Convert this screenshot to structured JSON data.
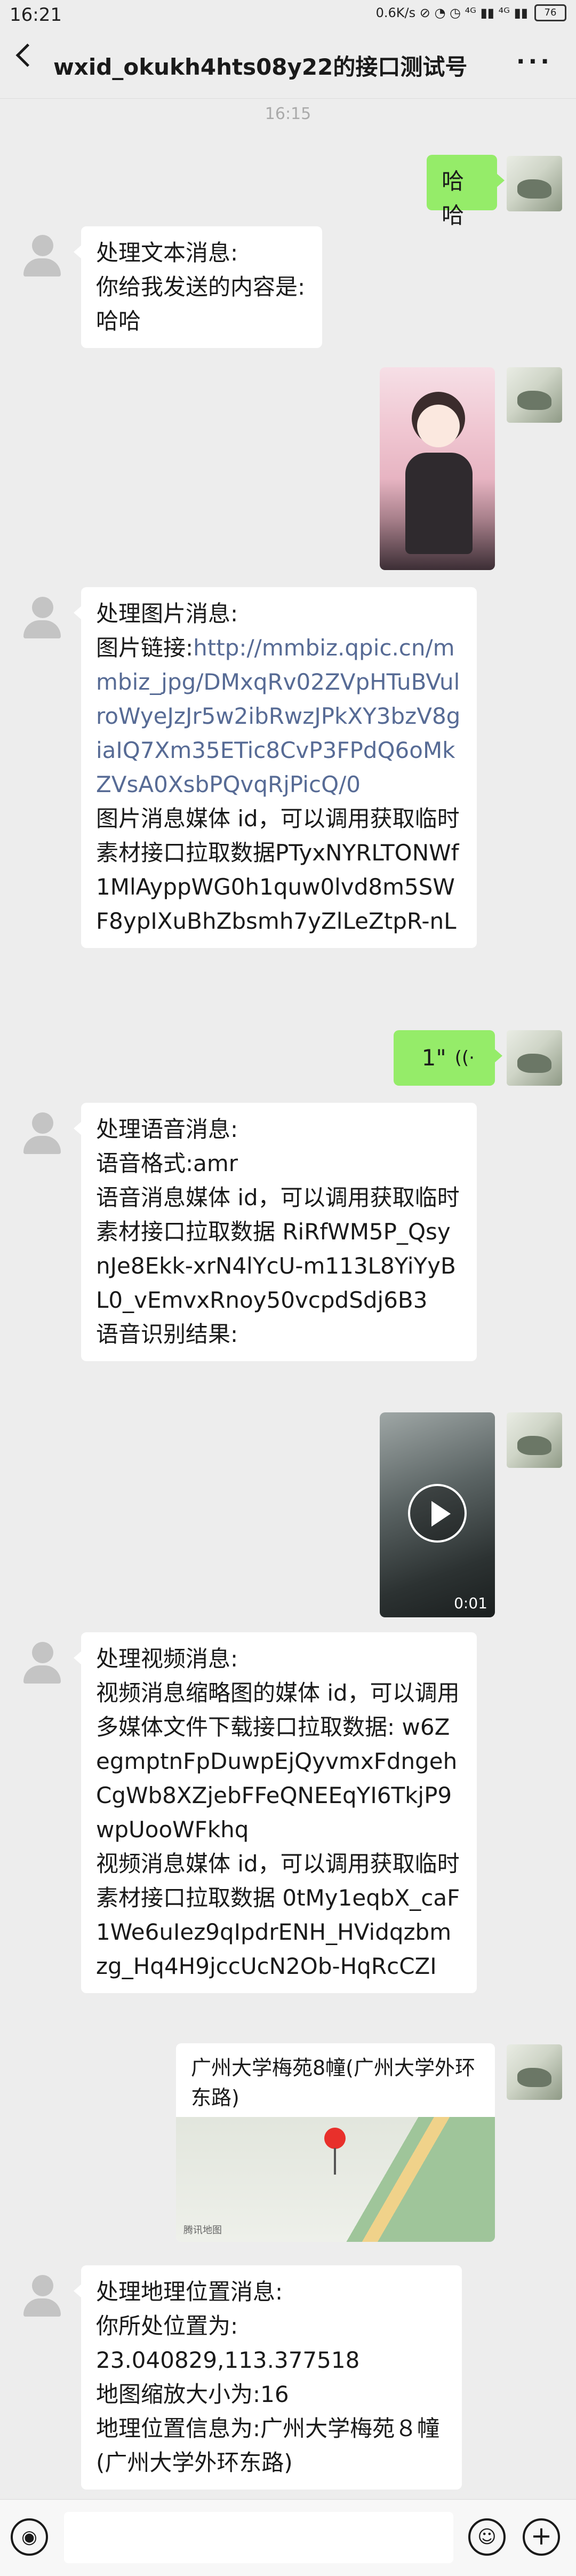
{
  "status_bar": {
    "time": "16:21",
    "indicators": "0.6K/s ⊘ ◔ ◷ ⁴ᴳ ▮▮ ⁴ᴳ ▮▮",
    "battery": "76"
  },
  "header": {
    "title": "wxid_okukh4hts08y22的接口测试号"
  },
  "timestamp": "16:15",
  "messages": {
    "m1_text": "哈哈",
    "m2_text": "处理文本消息:\n你给我发送的内容是:\n哈哈",
    "m4_prefix": "处理图片消息:\n图片链接:",
    "m4_link": "http://mmbiz.qpic.cn/mmbiz_jpg/DMxqRv02ZVpHTuBVulroWyeJzJr5w2ibRwzJPkXY3bzV8giaIQ7Xm35ETic8CvP3FPdQ6oMkZVsA0XsbPQvqRjPicQ/0",
    "m4_suffix": "图片消息媒体 id，可以调用获取临时素材接口拉取数据PTyxNYRLTONWf1MlAyppWG0h1quw0lvd8m5SWF8ypIXuBhZbsmh7yZlLeZtpR-nL",
    "m5_duration": "1\"",
    "m6_text": "处理语音消息:\n语音格式:amr\n语音消息媒体 id，可以调用获取临时素材接口拉取数据 RiRfWM5P_QsynJe8Ekk-xrN4lYcU-m113L8YiYyBL0_vEmvxRnoy50vcpdSdj6B3\n语音识别结果:",
    "m7_duration": "0:01",
    "m8_text": "处理视频消息:\n视频消息缩略图的媒体 id，可以调用多媒体文件下载接口拉取数据: w6ZegmptnFpDuwpEjQyvmxFdngehCgWb8XZjebFFeQNEEqYI6TkjP9wpUooWFkhq\n视频消息媒体 id，可以调用获取临时素材接口拉取数据 0tMy1eqbX_caF1We6uIez9qIpdrENH_HVidqzbmzg_Hq4H9jccUcN2Ob-HqRcCZI",
    "m9_location": "广州大学梅苑8幢(广州大学外环东路)",
    "m9_map_label": "腾讯地图",
    "m10_text": "处理地理位置消息:\n你所处位置为:\n23.040829,113.377518\n地图缩放大小为:16\n地理位置信息为:广州大学梅苑８幢(广州大学外环东路)"
  },
  "input_bar": {
    "voice_icon": "voice-icon",
    "emoji_icon": "emoji-icon",
    "plus_icon": "plus-icon"
  },
  "colors": {
    "background": "#ededed",
    "outgoing_bubble": "#95ec69",
    "incoming_bubble": "#ffffff",
    "link": "#576b95"
  }
}
